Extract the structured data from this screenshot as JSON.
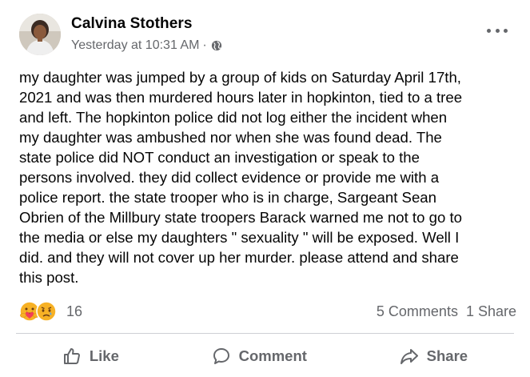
{
  "post": {
    "author": "Calvina Stothers",
    "timestamp": "Yesterday at 10:31 AM",
    "separator": "·",
    "privacy_icon": "globe-icon",
    "more_icon": "more-options-icon",
    "body_lines": [
      "my daughter was jumped by a group of kids on Saturday April 17th,",
      "2021 and was then murdered hours later in hopkinton, tied to a tree",
      "and left. The hopkinton police did not log either the incident when",
      "my daughter was ambushed nor when she was found dead. The",
      "state police did NOT conduct an investigation or speak to the",
      "persons involved. they did collect evidence or provide me with a",
      "police report. the state trooper who is in charge, Sargeant Sean",
      "Obrien of the Millbury state troopers Barack warned me not to go to",
      "the media or else my daughters \" sexuality \" will be exposed. Well I",
      "did. and they will not cover up her murder. please attend and share",
      "this post."
    ]
  },
  "reactions": {
    "icons": [
      "care-reaction-icon",
      "sad-reaction-icon"
    ],
    "count": "16"
  },
  "engagement": {
    "comments": "5 Comments",
    "shares": "1 Share"
  },
  "actions": {
    "like": "Like",
    "comment": "Comment",
    "share": "Share"
  },
  "colors": {
    "text": "#050505",
    "secondary": "#65676b",
    "divider": "#ced0d4",
    "reaction_yellow": "#f7b125",
    "care_red": "#f33e58"
  }
}
